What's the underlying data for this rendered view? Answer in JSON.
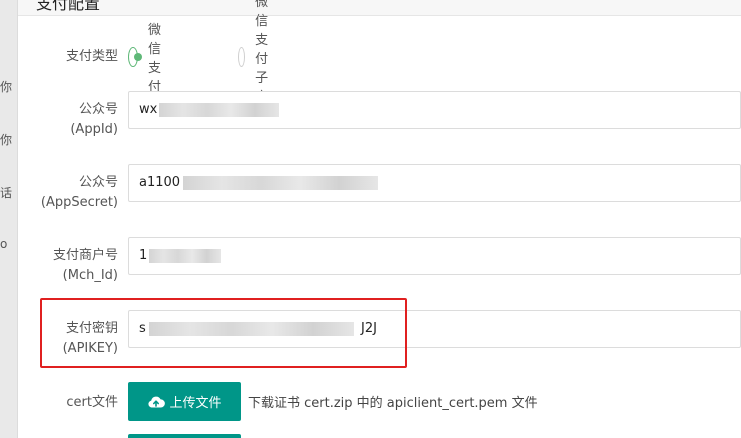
{
  "sidebar": {
    "fragments": [
      "你",
      "你",
      "话",
      "o"
    ]
  },
  "panel": {
    "title": "支付配置"
  },
  "pay_type": {
    "label": "支付类型",
    "options": [
      {
        "label": "微信支付",
        "selected": true
      },
      {
        "label": "微信支付子商户",
        "selected": false
      }
    ]
  },
  "fields": {
    "appid": {
      "label_main": "公众号",
      "label_sub": "(AppId)",
      "value_visible": "wx",
      "redacted": true
    },
    "appsecret": {
      "label_main": "公众号",
      "label_sub": "(AppSecret)",
      "value_visible": "a1100",
      "redacted": true
    },
    "mch_id": {
      "label_main": "支付商户号",
      "label_sub": "(Mch_Id)",
      "value_visible": "1",
      "redacted": true
    },
    "apikey": {
      "label_main": "支付密钥",
      "label_sub": "(APIKEY)",
      "value_visible": "s",
      "value_tail": "J2J",
      "redacted": true,
      "highlighted": true
    }
  },
  "cert": {
    "label": "cert文件",
    "upload_label": "上传文件",
    "hint": "下载证书 cert.zip 中的 apiclient_cert.pem 文件"
  },
  "colors": {
    "accent": "#009688",
    "radio_active": "#5fb878",
    "highlight": "#e02020"
  }
}
